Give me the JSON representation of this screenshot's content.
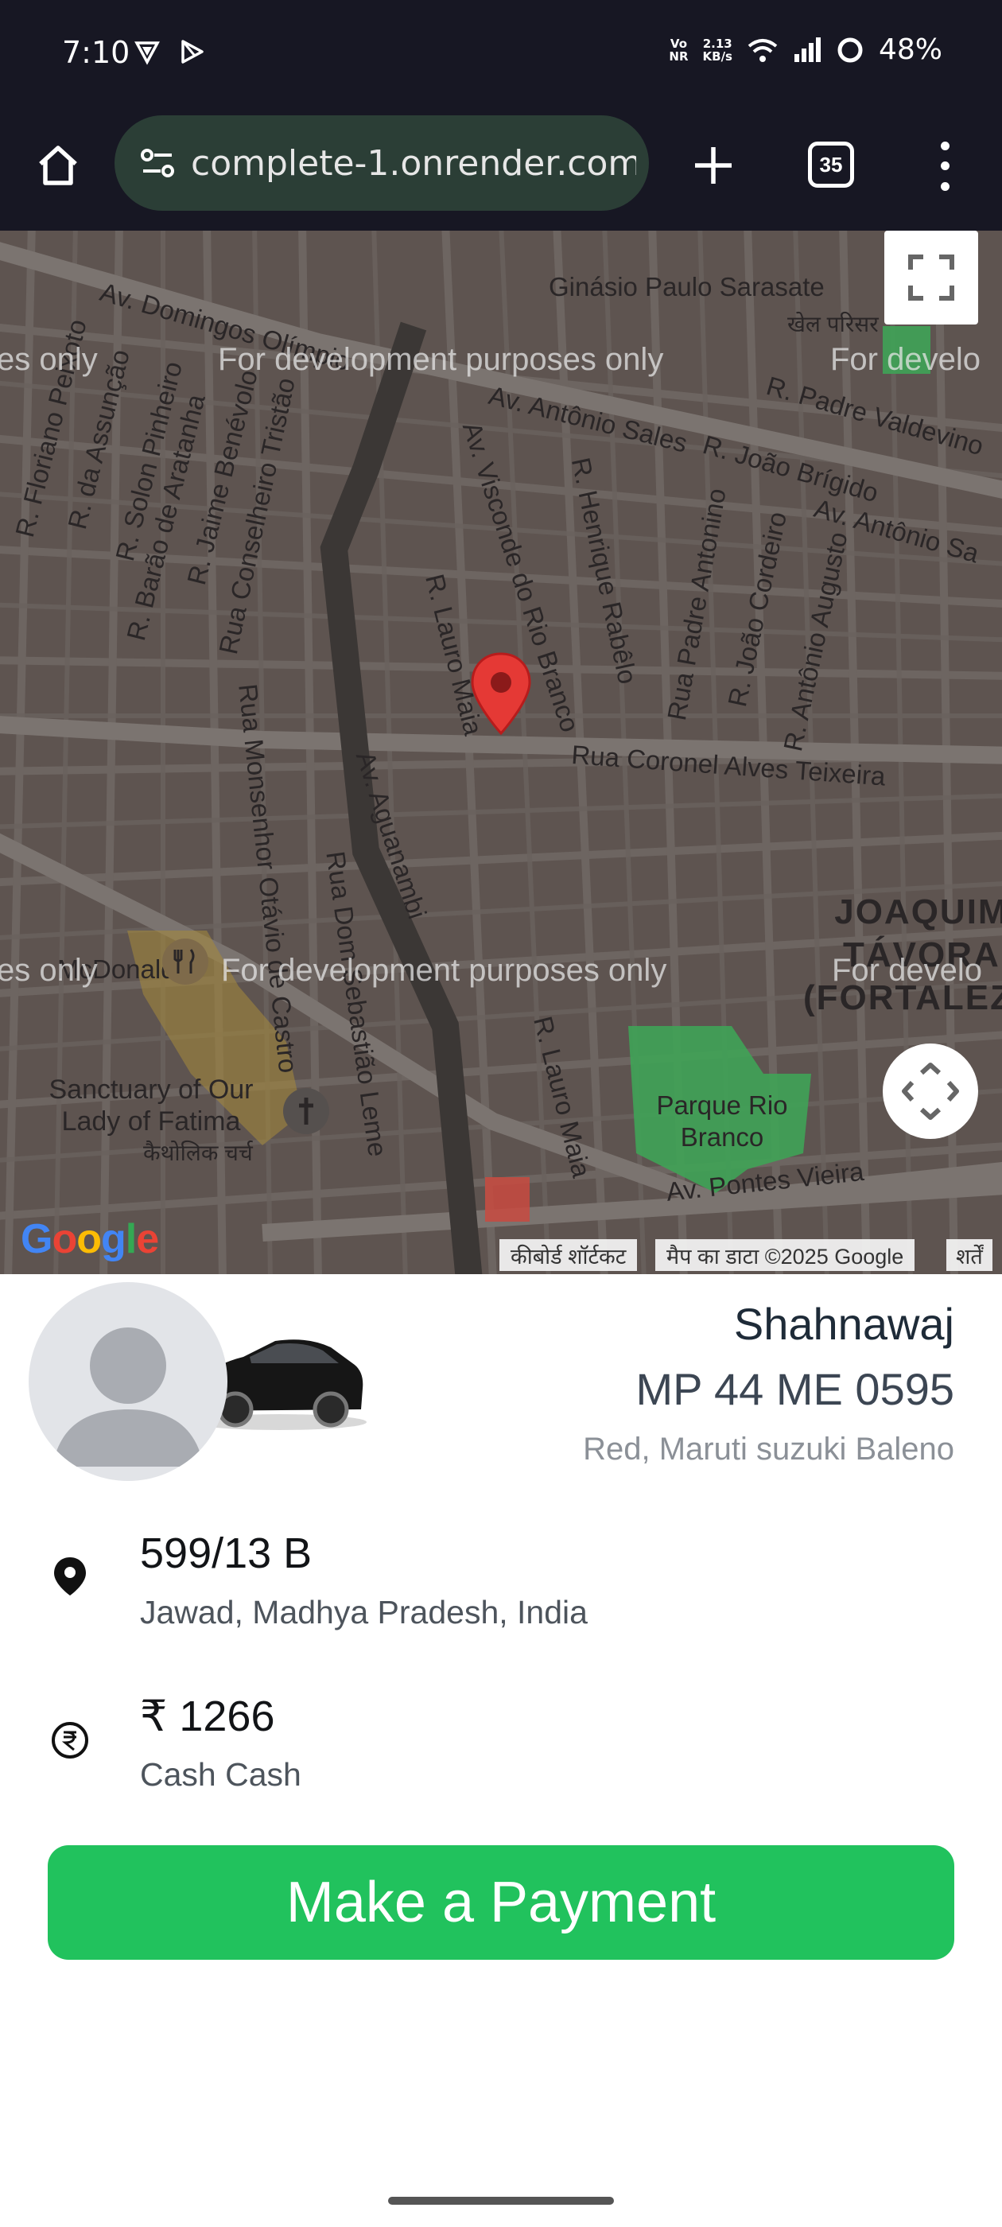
{
  "status_bar": {
    "time": "7:10",
    "net_top": "Vo",
    "net_bottom": "NR",
    "speed_value": "2.13",
    "speed_unit": "KB/s",
    "battery": "48%"
  },
  "browser": {
    "url": "complete-1.onrender.com",
    "tab_count": "35"
  },
  "map": {
    "streets": [
      "Av. Domingos Olímpio",
      "Ginásio Paulo Sarasate",
      "खेल परिसर",
      "Av. Antônio Sales",
      "R. João Brígido",
      "R. Padre Valdevino",
      "Av. Antônio Sa",
      "R. Floriano Peixoto",
      "R. da Assunção",
      "R. Solon Pinheiro",
      "R. Barão de Aratanha",
      "R. Jaime Benévolo",
      "Rua Conselheiro Tristão",
      "Av. Visconde do Rio Branco",
      "R. Henrique Rabêlo",
      "Rua Padre Antonino",
      "R. João Cordeiro",
      "R. Antônio Augusto",
      "R. Lauro Maia",
      "Rua Coronel Alves Teixeira",
      "Rua Monsenhor Otávio de Castro",
      "Av. Aguanambi",
      "Rua Dom Sebastião Leme",
      "Parque Rio Branco",
      "Av. Pontes Vieira",
      "McDonald's",
      "Sanctuary of Our Lady of Fatima",
      "कैथोलिक चर्च"
    ],
    "district": [
      "JOAQUIM",
      "TÁVORA",
      "(FORTALEZA"
    ],
    "dev_watermark": "For development purposes only",
    "dev_fragment_left": "es only",
    "dev_fragment_right": "For develo",
    "google_logo": "Google",
    "attribution": [
      "कीबोर्ड शॉर्टकट",
      "मैप का डाटा ©2025 Google",
      "शर्तें"
    ]
  },
  "driver": {
    "name": "Shahnawaj",
    "plate": "MP 44 ME 0595",
    "vehicle": "Red, Maruti suzuki Baleno"
  },
  "destination": {
    "title": "599/13 B",
    "subtitle": "Jawad, Madhya Pradesh, India"
  },
  "fare": {
    "amount": "₹ 1266",
    "method": "Cash Cash"
  },
  "actions": {
    "pay_label": "Make a Payment"
  },
  "colors": {
    "accent_green": "#21c25d",
    "map_bg": "#5e5450",
    "pin_red": "#e53935"
  }
}
